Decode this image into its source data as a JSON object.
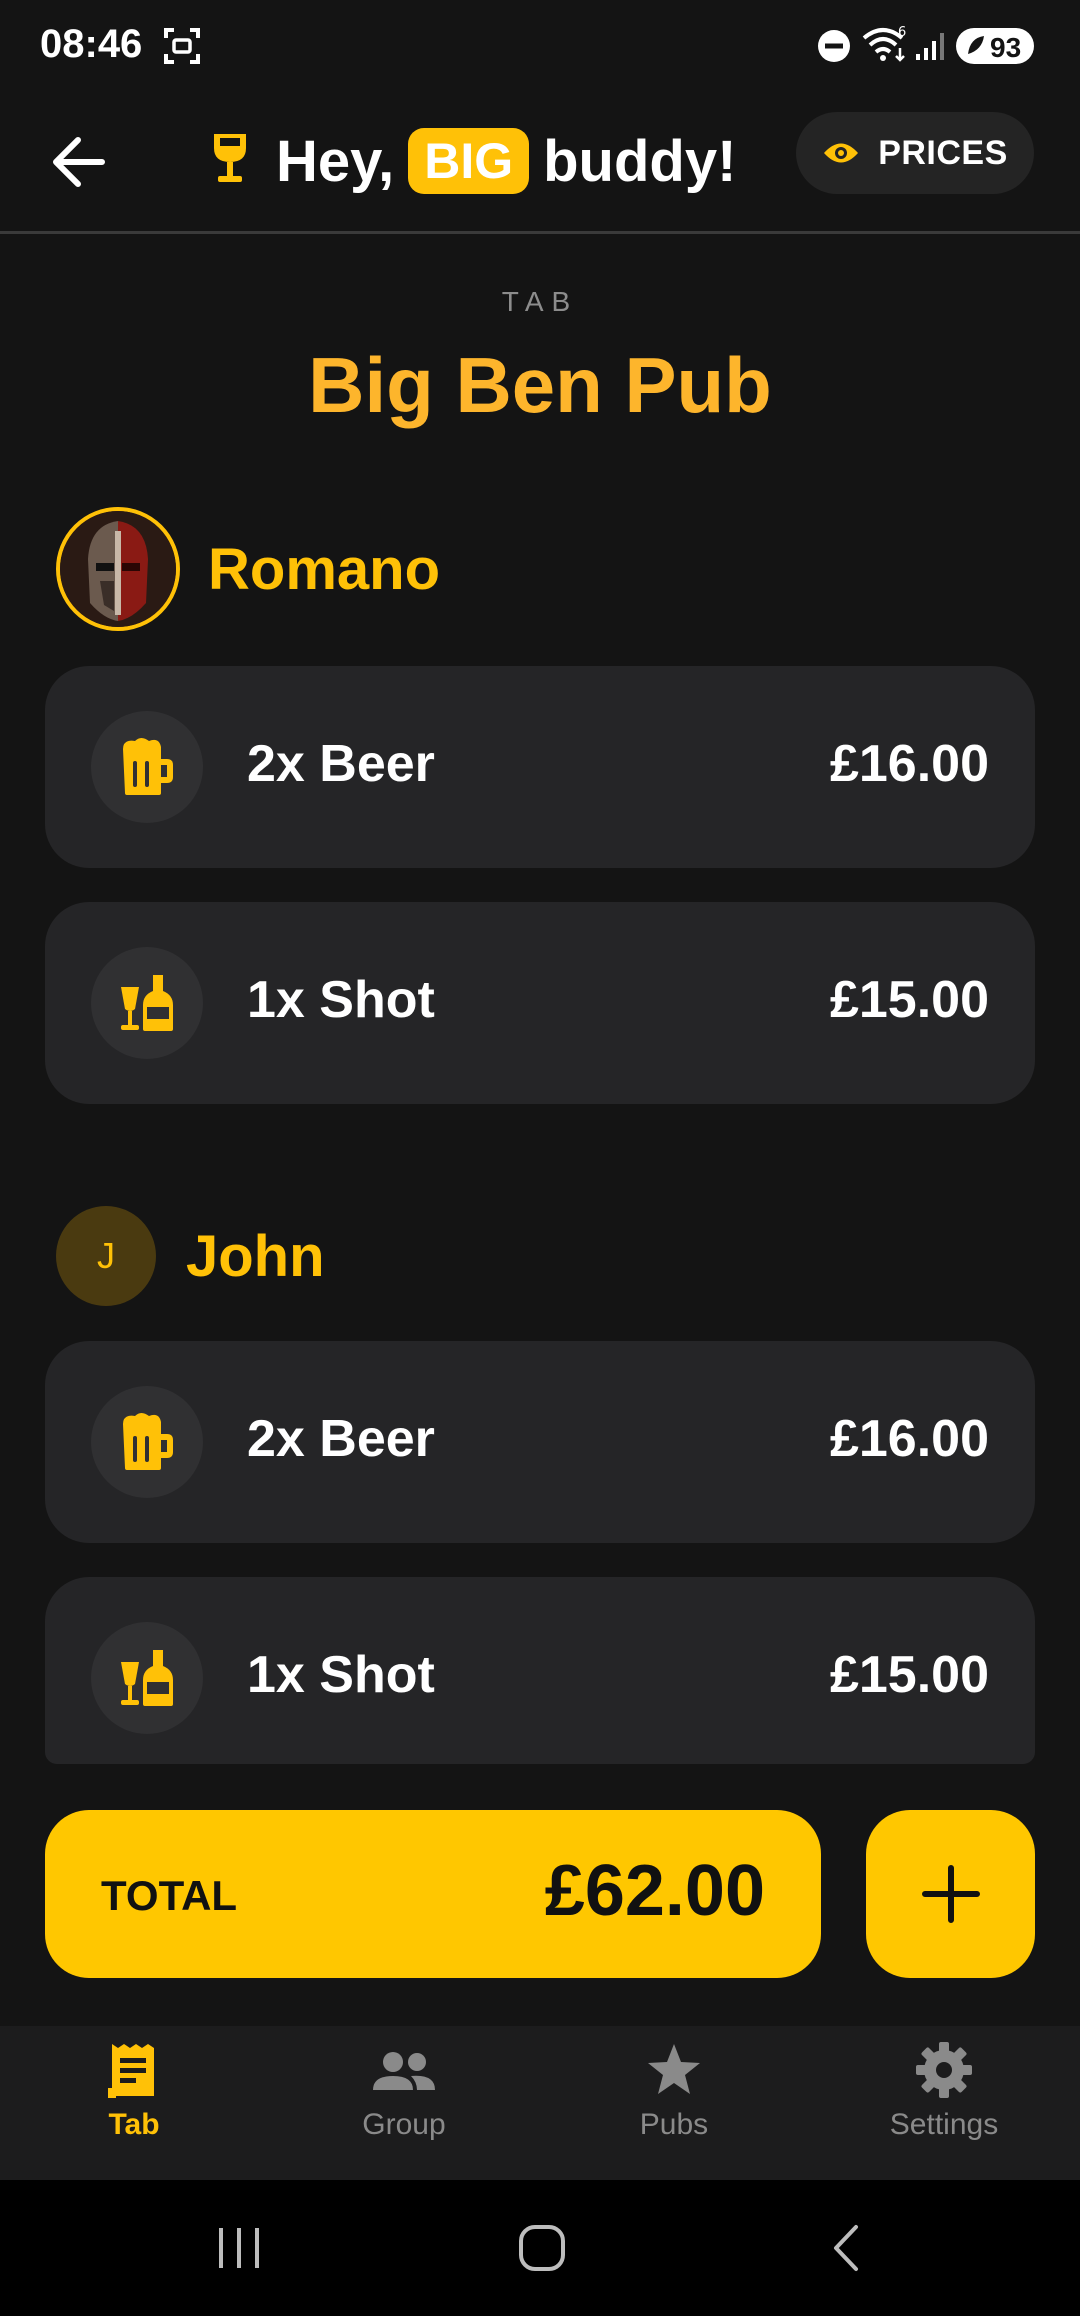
{
  "status_bar": {
    "time": "08:46",
    "battery": "93"
  },
  "header": {
    "greeting_prefix": "Hey,",
    "greeting_badge": "BIG",
    "greeting_suffix": "buddy!",
    "prices_label": "PRICES"
  },
  "tab": {
    "label": "TAB",
    "pub_name": "Big Ben Pub"
  },
  "people": [
    {
      "name": "Romano",
      "items": [
        {
          "icon": "beer-mug-icon",
          "label": "2x Beer",
          "price": "£16.00"
        },
        {
          "icon": "shot-bottle-icon",
          "label": "1x Shot",
          "price": "£15.00"
        }
      ]
    },
    {
      "name": "John",
      "initial": "J",
      "items": [
        {
          "icon": "beer-mug-icon",
          "label": "2x Beer",
          "price": "£16.00"
        },
        {
          "icon": "shot-bottle-icon",
          "label": "1x Shot",
          "price": "£15.00"
        }
      ]
    }
  ],
  "total": {
    "label": "TOTAL",
    "value": "£62.00"
  },
  "bottom_nav": [
    {
      "label": "Tab",
      "icon": "receipt-icon",
      "active": true
    },
    {
      "label": "Group",
      "icon": "group-icon",
      "active": false
    },
    {
      "label": "Pubs",
      "icon": "star-icon",
      "active": false
    },
    {
      "label": "Settings",
      "icon": "gear-icon",
      "active": false
    }
  ],
  "colors": {
    "accent": "#FFC107",
    "pub_name": "#FDB52C",
    "background": "#141414",
    "card": "#252527"
  }
}
